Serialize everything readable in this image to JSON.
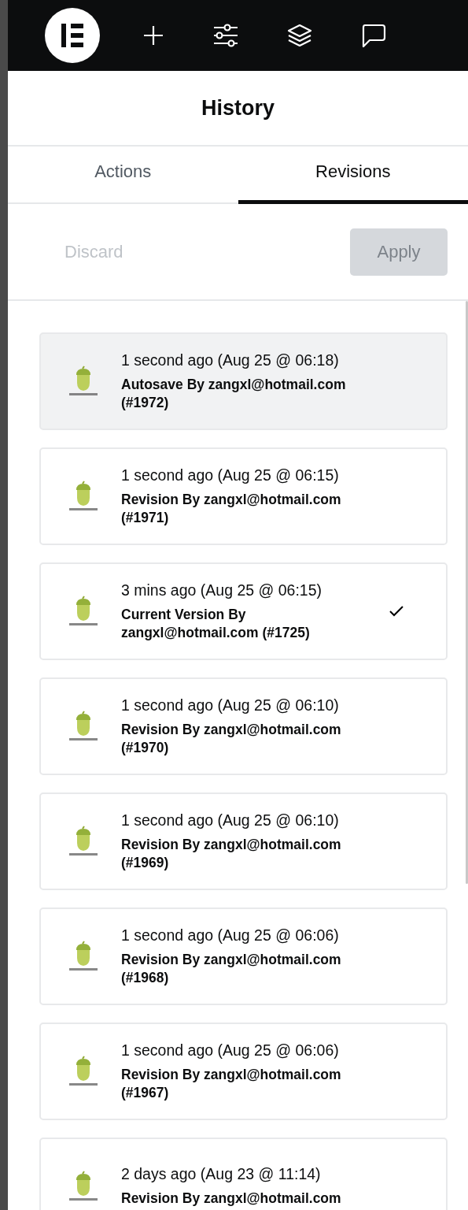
{
  "panel": {
    "title": "History"
  },
  "tabs": [
    {
      "label": "Actions",
      "selected": false
    },
    {
      "label": "Revisions",
      "selected": true
    }
  ],
  "actions": {
    "discard": "Discard",
    "apply": "Apply",
    "apply_disabled": true
  },
  "revisions": [
    {
      "time": "1 second ago (Aug 25 @ 06:18)",
      "author": "Autosave By zangxl@hotmail.com (#1972)",
      "selected": true,
      "current": false
    },
    {
      "time": "1 second ago (Aug 25 @ 06:15)",
      "author": "Revision By zangxl@hotmail.com (#1971)",
      "selected": false,
      "current": false
    },
    {
      "time": "3 mins ago (Aug 25 @ 06:15)",
      "author": "Current Version By zangxl@hotmail.com (#1725)",
      "selected": false,
      "current": true
    },
    {
      "time": "1 second ago (Aug 25 @ 06:10)",
      "author": "Revision By zangxl@hotmail.com (#1970)",
      "selected": false,
      "current": false
    },
    {
      "time": "1 second ago (Aug 25 @ 06:10)",
      "author": "Revision By zangxl@hotmail.com (#1969)",
      "selected": false,
      "current": false
    },
    {
      "time": "1 second ago (Aug 25 @ 06:06)",
      "author": "Revision By zangxl@hotmail.com (#1968)",
      "selected": false,
      "current": false
    },
    {
      "time": "1 second ago (Aug 25 @ 06:06)",
      "author": "Revision By zangxl@hotmail.com (#1967)",
      "selected": false,
      "current": false
    },
    {
      "time": "2 days ago (Aug 23 @ 11:14)",
      "author": "Revision By zangxl@hotmail.com",
      "selected": false,
      "current": false
    }
  ]
}
